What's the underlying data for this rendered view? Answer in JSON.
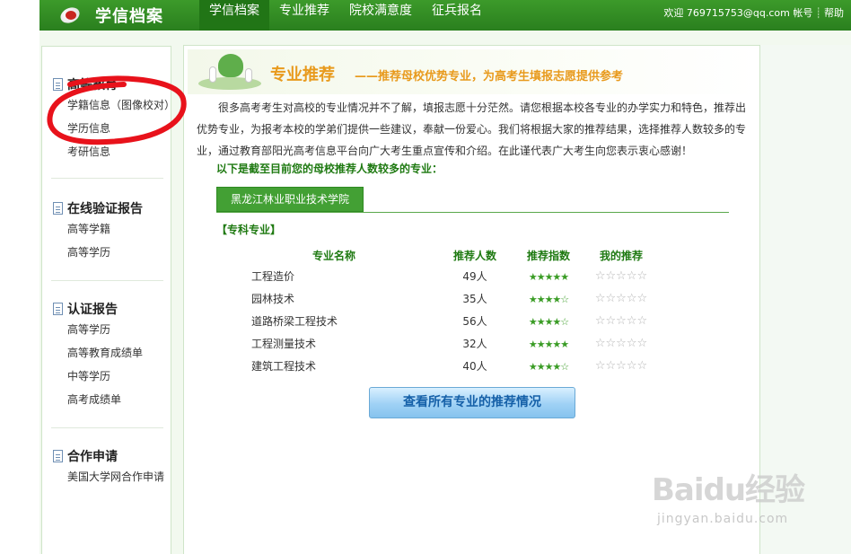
{
  "header": {
    "app_title": "学信档案",
    "nav": [
      "学信档案",
      "专业推荐",
      "院校满意度",
      "征兵报名"
    ],
    "welcome": "欢迎",
    "user_email": "769715753@qq.com",
    "account": "帐号",
    "help": "帮助"
  },
  "sidebar": {
    "groups": [
      {
        "title": "高等教育",
        "items": [
          "学籍信息（图像校对）",
          "学历信息",
          "考研信息"
        ]
      },
      {
        "title": "在线验证报告",
        "items": [
          "高等学籍",
          "高等学历"
        ]
      },
      {
        "title": "认证报告",
        "items": [
          "高等学历",
          "高等教育成绩单",
          "中等学历",
          "高考成绩单"
        ]
      },
      {
        "title": "合作申请",
        "items": [
          "美国大学网合作申请"
        ]
      }
    ]
  },
  "main": {
    "banner_title": "专业推荐",
    "banner_subtitle": "——推荐母校优势专业，为高考生填报志愿提供参考",
    "intro": "很多高考考生对高校的专业情况并不了解，填报志愿十分茫然。请您根据本校各专业的办学实力和特色，推荐出优势专业，为报考本校的学弟们提供一些建议，奉献一份爱心。我们将根据大家的推荐结果，选择推荐人数较多的专业，通过教育部阳光高考信息平台向广大考生重点宣传和介绍。在此谨代表广大考生向您表示衷心感谢！",
    "subhead": "以下是截至目前您的母校推荐人数较多的专业：",
    "school_tab": "黑龙江林业职业技术学院",
    "section_label": "【专科专业】",
    "table": {
      "headers": [
        "专业名称",
        "推荐人数",
        "推荐指数",
        "我的推荐"
      ],
      "rows": [
        {
          "name": "工程造价",
          "count": "49人",
          "index_stars": 5,
          "index_text": "★★★★★",
          "mine_text": "☆☆☆☆☆"
        },
        {
          "name": "园林技术",
          "count": "35人",
          "index_stars": 4,
          "index_text": "★★★★☆",
          "mine_text": "☆☆☆☆☆"
        },
        {
          "name": "道路桥梁工程技术",
          "count": "56人",
          "index_stars": 4,
          "index_text": "★★★★☆",
          "mine_text": "☆☆☆☆☆"
        },
        {
          "name": "工程测量技术",
          "count": "32人",
          "index_stars": 5,
          "index_text": "★★★★★",
          "mine_text": "☆☆☆☆☆"
        },
        {
          "name": "建筑工程技术",
          "count": "40人",
          "index_stars": 4,
          "index_text": "★★★★☆",
          "mine_text": "☆☆☆☆☆"
        }
      ]
    },
    "view_all_button": "查看所有专业的推荐情况"
  },
  "watermark": {
    "main": "Baidu经验",
    "sub": "jingyan.baidu.com"
  },
  "colors": {
    "nav_green": "#2a7f1e",
    "accent_orange": "#e89a1d",
    "text_green": "#1f7a12",
    "annotation_red": "#e8121b"
  }
}
